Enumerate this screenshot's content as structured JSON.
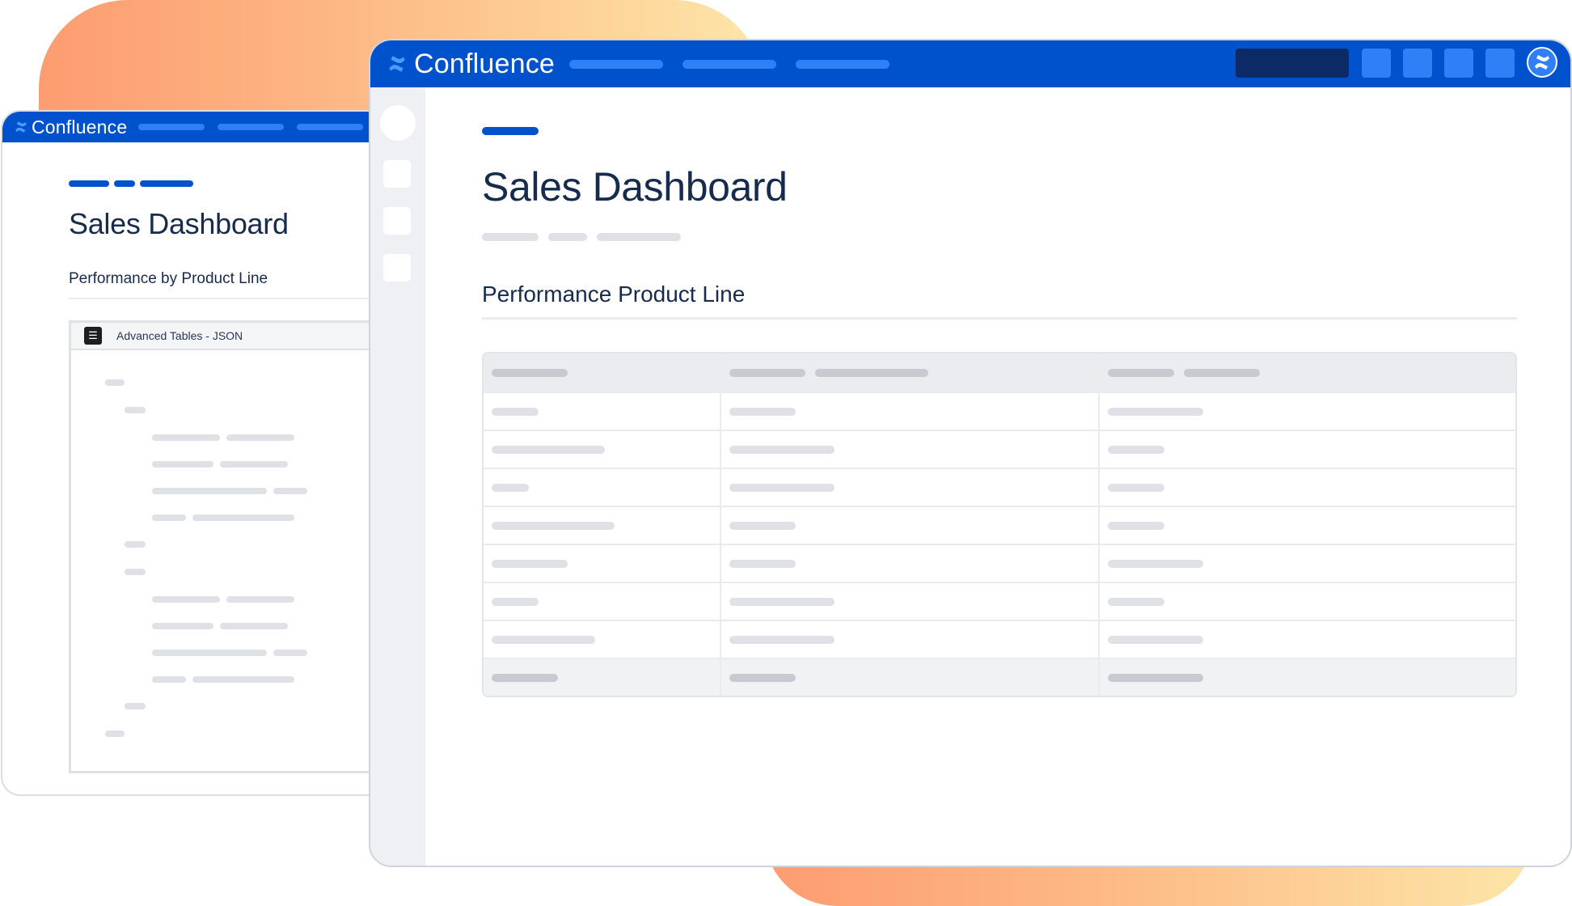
{
  "colors": {
    "brand_blue": "#0052cc",
    "nav_pill_blue": "#2f7ff6",
    "search_dark": "#0b2a66",
    "gradient": [
      "#fd9c70",
      "#fdba86",
      "#fde6a8"
    ],
    "text": "#172b4d",
    "skeleton": "#dfe1e6"
  },
  "back_window": {
    "app_name": "Confluence",
    "logo_icon": "confluence-logo-icon",
    "page_title": "Sales Dashboard",
    "section_heading": "Performance by Product Line",
    "macro": {
      "icon": "table-icon",
      "label": "Advanced Tables - JSON"
    }
  },
  "front_window": {
    "app_name": "Confluence",
    "logo_icon": "confluence-logo-icon",
    "page_title": "Sales Dashboard",
    "section_heading": "Performance Product Line",
    "table": {
      "columns": 3,
      "body_rows": 7,
      "footer_rows": 1
    },
    "avatar_icon": "user-avatar-icon"
  }
}
